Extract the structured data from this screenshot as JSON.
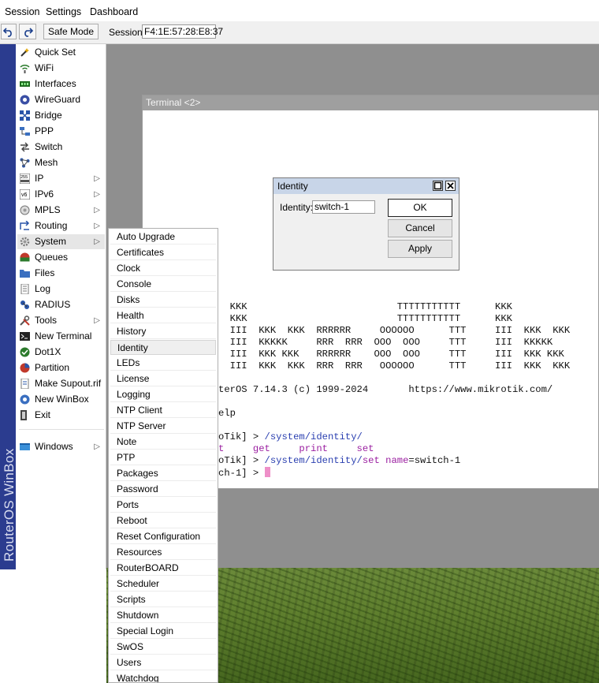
{
  "menubar": {
    "items": [
      "Session",
      "Settings",
      "Dashboard"
    ]
  },
  "toolbar": {
    "undo_icon": "undo-icon",
    "redo_icon": "redo-icon",
    "safe_mode_label": "Safe Mode",
    "session_label": "Session:",
    "session_value": "F4:1E:57:28:E8:37"
  },
  "sidebar": {
    "brand": "RouterOS WinBox",
    "items": [
      {
        "label": "Quick Set",
        "icon": "wand-icon",
        "submenu": false
      },
      {
        "label": "WiFi",
        "icon": "wifi-icon",
        "submenu": false
      },
      {
        "label": "Interfaces",
        "icon": "interfaces-icon",
        "submenu": false
      },
      {
        "label": "WireGuard",
        "icon": "wireguard-icon",
        "submenu": false
      },
      {
        "label": "Bridge",
        "icon": "bridge-icon",
        "submenu": false
      },
      {
        "label": "PPP",
        "icon": "ppp-icon",
        "submenu": false
      },
      {
        "label": "Switch",
        "icon": "switch-icon",
        "submenu": false
      },
      {
        "label": "Mesh",
        "icon": "mesh-icon",
        "submenu": false
      },
      {
        "label": "IP",
        "icon": "ip-icon",
        "submenu": true
      },
      {
        "label": "IPv6",
        "icon": "ipv6-icon",
        "submenu": true
      },
      {
        "label": "MPLS",
        "icon": "mpls-icon",
        "submenu": true
      },
      {
        "label": "Routing",
        "icon": "routing-icon",
        "submenu": true
      },
      {
        "label": "System",
        "icon": "gear-icon",
        "submenu": true
      },
      {
        "label": "Queues",
        "icon": "queues-icon",
        "submenu": false
      },
      {
        "label": "Files",
        "icon": "folder-icon",
        "submenu": false
      },
      {
        "label": "Log",
        "icon": "log-icon",
        "submenu": false
      },
      {
        "label": "RADIUS",
        "icon": "radius-icon",
        "submenu": false
      },
      {
        "label": "Tools",
        "icon": "tools-icon",
        "submenu": true
      },
      {
        "label": "New Terminal",
        "icon": "terminal-icon",
        "submenu": false
      },
      {
        "label": "Dot1X",
        "icon": "dot1x-icon",
        "submenu": false
      },
      {
        "label": "Partition",
        "icon": "partition-icon",
        "submenu": false
      },
      {
        "label": "Make Supout.rif",
        "icon": "supout-icon",
        "submenu": false
      },
      {
        "label": "New WinBox",
        "icon": "winbox-icon",
        "submenu": false
      },
      {
        "label": "Exit",
        "icon": "exit-icon",
        "submenu": false
      },
      {
        "label": "Windows",
        "icon": "windows-icon",
        "submenu": true
      }
    ],
    "selected": "System"
  },
  "submenu": {
    "items": [
      "Auto Upgrade",
      "Certificates",
      "Clock",
      "Console",
      "Disks",
      "Health",
      "History",
      "Identity",
      "LEDs",
      "License",
      "Logging",
      "NTP Client",
      "NTP Server",
      "Note",
      "PTP",
      "Packages",
      "Password",
      "Ports",
      "Reboot",
      "Reset Configuration",
      "Resources",
      "RouterBOARD",
      "Scheduler",
      "Scripts",
      "Shutdown",
      "Special Login",
      "SwOS",
      "Users",
      "Watchdog"
    ],
    "highlighted": "Identity"
  },
  "terminal": {
    "title": "Terminal <2>",
    "banner": [
      "  KKK                          TTTTTTTTTTT      KKK",
      "  KKK                          TTTTTTTTTTT      KKK",
      "  III  KKK  KKK  RRRRRR     OOOOOO      TTT     III  KKK  KKK",
      "  III  KKKKK     RRR  RRR  OOO  OOO     TTT     III  KKKKK",
      "  III  KKK KKK   RRRRRR    OOO  OOO     TTT     III  KKK KKK",
      "  III  KKK  KKK  RRR  RRR   OOOOOO      TTT     III  KKK  KKK"
    ],
    "version_line": "terOS 7.14.3 (c) 1999-2024       https://www.mikrotik.com/",
    "help_line": "elp",
    "prompt1_prefix": "oTik] > ",
    "prompt1_cmd": "/system/identity/",
    "completions": "t     get     print     set",
    "prompt2_prefix": "oTik] > ",
    "prompt2_path": "/system/identity/",
    "prompt2_kw": "set",
    "prompt2_arg": " name",
    "prompt2_eq": "=",
    "prompt2_val": "switch-1",
    "prompt3_prefix": "ch-1] > "
  },
  "dialog": {
    "title": "Identity",
    "field_label": "Identity:",
    "field_value": "switch-1",
    "ok_label": "OK",
    "cancel_label": "Cancel",
    "apply_label": "Apply",
    "maximize_icon": "maximize-icon",
    "close_icon": "close-icon"
  }
}
